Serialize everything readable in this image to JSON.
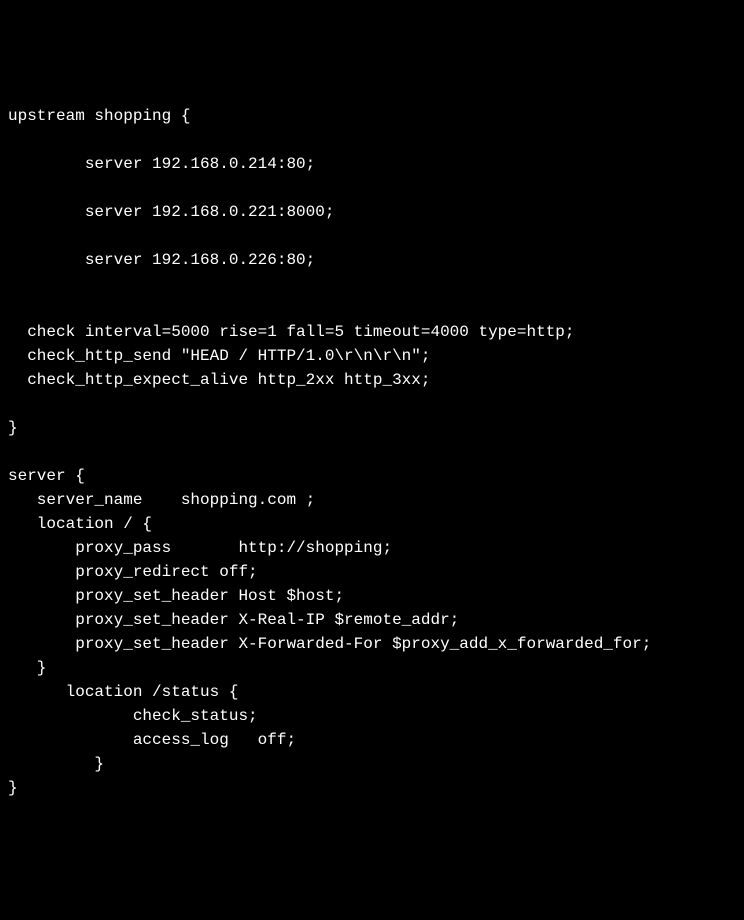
{
  "config": {
    "line1": "upstream shopping {",
    "line2": "",
    "line3": "        server 192.168.0.214:80;",
    "line4": "",
    "line5": "        server 192.168.0.221:8000;",
    "line6": "",
    "line7": "        server 192.168.0.226:80;",
    "line8": "",
    "line9": "",
    "line10": "  check interval=5000 rise=1 fall=5 timeout=4000 type=http;",
    "line11": "  check_http_send \"HEAD / HTTP/1.0\\r\\n\\r\\n\";",
    "line12": "  check_http_expect_alive http_2xx http_3xx;",
    "line13": "",
    "line14": "}",
    "line15": "",
    "line16": "server {",
    "line17": "   server_name    shopping.com ;",
    "line18": "   location / {",
    "line19": "       proxy_pass       http://shopping;",
    "line20": "       proxy_redirect off;",
    "line21": "       proxy_set_header Host $host;",
    "line22": "       proxy_set_header X-Real-IP $remote_addr;",
    "line23": "       proxy_set_header X-Forwarded-For $proxy_add_x_forwarded_for;",
    "line24": "   }",
    "line25": "      location /status {",
    "line26": "             check_status;",
    "line27": "             access_log   off;",
    "line28": "         }",
    "line29": "}"
  }
}
